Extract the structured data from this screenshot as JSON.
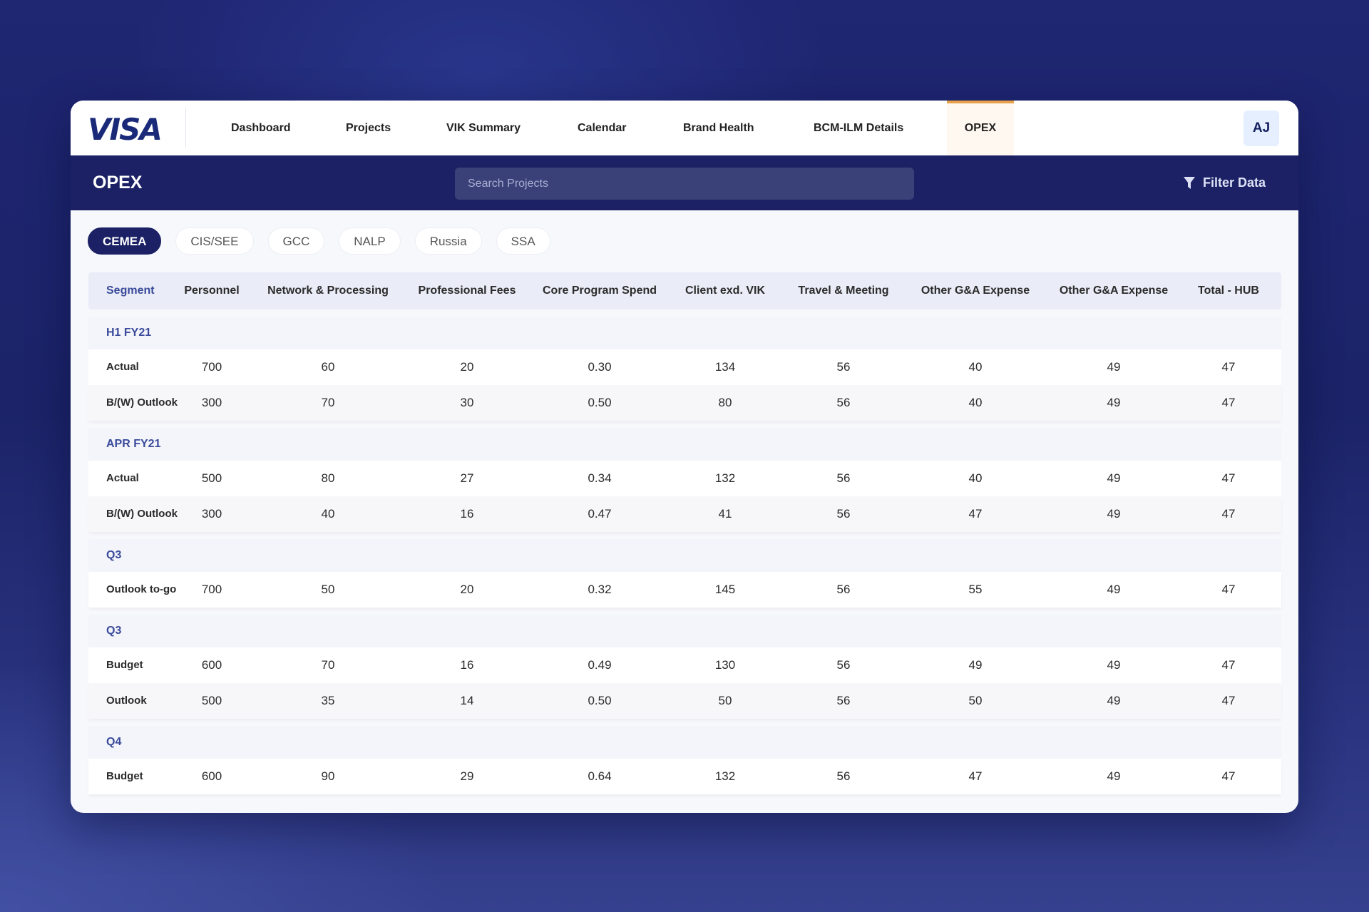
{
  "brand": {
    "logo_text": "VISA"
  },
  "nav": {
    "items": [
      {
        "label": "Dashboard"
      },
      {
        "label": "Projects"
      },
      {
        "label": "VIK Summary"
      },
      {
        "label": "Calendar"
      },
      {
        "label": "Brand Health"
      },
      {
        "label": "BCM-ILM Details"
      },
      {
        "label": "OPEX",
        "active": true
      }
    ],
    "avatar_initials": "AJ"
  },
  "header": {
    "title": "OPEX",
    "search_placeholder": "Search Projects",
    "filter_label": "Filter Data",
    "filter_icon": "funnel-icon"
  },
  "regions": {
    "items": [
      "CEMEA",
      "CIS/SEE",
      "GCC",
      "NALP",
      "Russia",
      "SSA"
    ],
    "selected": "CEMEA"
  },
  "table": {
    "columns": [
      "Segment",
      "Personnel",
      "Network & Processing",
      "Professional Fees",
      "Core Program Spend",
      "Client exd. VIK",
      "Travel & Meeting",
      "Other G&A Expense",
      "Other G&A Expense",
      "Total - HUB"
    ],
    "groups": [
      {
        "label": "H1 FY21",
        "rows": [
          [
            "Actual",
            "700",
            "60",
            "20",
            "0.30",
            "134",
            "56",
            "40",
            "49",
            "47"
          ],
          [
            "B/(W) Outlook",
            "300",
            "70",
            "30",
            "0.50",
            "80",
            "56",
            "40",
            "49",
            "47"
          ]
        ]
      },
      {
        "label": "APR FY21",
        "rows": [
          [
            "Actual",
            "500",
            "80",
            "27",
            "0.34",
            "132",
            "56",
            "40",
            "49",
            "47"
          ],
          [
            "B/(W) Outlook",
            "300",
            "40",
            "16",
            "0.47",
            "41",
            "56",
            "47",
            "49",
            "47"
          ]
        ]
      },
      {
        "label": "Q3",
        "rows": [
          [
            "Outlook to-go",
            "700",
            "50",
            "20",
            "0.32",
            "145",
            "56",
            "55",
            "49",
            "47"
          ]
        ]
      },
      {
        "label": "Q3",
        "rows": [
          [
            "Budget",
            "600",
            "70",
            "16",
            "0.49",
            "130",
            "56",
            "49",
            "49",
            "47"
          ],
          [
            "Outlook",
            "500",
            "35",
            "14",
            "0.50",
            "50",
            "56",
            "50",
            "49",
            "47"
          ]
        ]
      },
      {
        "label": "Q4",
        "rows": [
          [
            "Budget",
            "600",
            "90",
            "29",
            "0.64",
            "132",
            "56",
            "47",
            "49",
            "47"
          ]
        ]
      }
    ]
  },
  "colors": {
    "primary": "#1b2164",
    "accent": "#e8a04a",
    "group_label": "#3a4a9a"
  }
}
